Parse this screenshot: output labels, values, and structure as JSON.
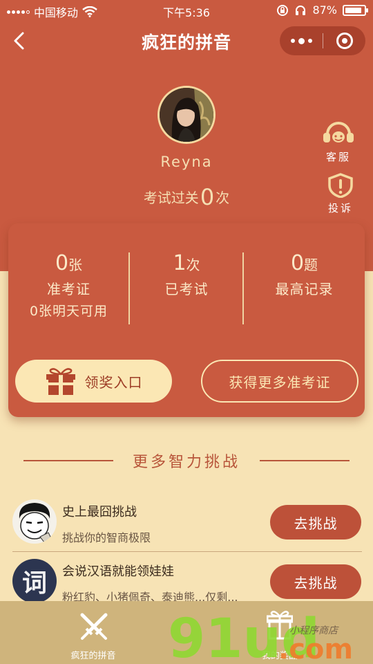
{
  "status_bar": {
    "carrier": "中国移动",
    "time": "下午5:36",
    "battery": "87%",
    "battery_level": 0.87
  },
  "nav": {
    "title": "疯狂的拼音"
  },
  "profile": {
    "name": "Reyna",
    "pass_prefix": "考试过关",
    "pass_count": "0",
    "pass_suffix": "次"
  },
  "side_buttons": {
    "service": "客服",
    "complaint": "投诉"
  },
  "stats": {
    "tickets": {
      "value": "0",
      "unit": "张",
      "label": "准考证",
      "sub": "0张明天可用"
    },
    "exams": {
      "value": "1",
      "unit": "次",
      "label": "已考试"
    },
    "best": {
      "value": "0",
      "unit": "题",
      "label": "最高记录"
    }
  },
  "actions": {
    "reward": "领奖入口",
    "more_tickets": "获得更多准考证"
  },
  "section": {
    "title": "更多智力挑战"
  },
  "challenges": [
    {
      "name": "史上最囧挑战",
      "desc": "挑战你的智商极限",
      "button": "去挑战"
    },
    {
      "name": "会说汉语就能领娃娃",
      "desc": "粉红豹、小猪佩奇、泰迪熊...仅剩...",
      "button": "去挑战",
      "icon_char": "词"
    }
  ],
  "tabs": [
    {
      "label": "疯狂的拼音"
    },
    {
      "label": "我的奖品"
    }
  ],
  "watermark": {
    "text": "91ud.com",
    "sub": "小程序商店"
  },
  "colors": {
    "primary": "#c95a40",
    "cream": "#f7e3b5",
    "button": "#bd5139",
    "tabbar": "#cfb47c"
  }
}
